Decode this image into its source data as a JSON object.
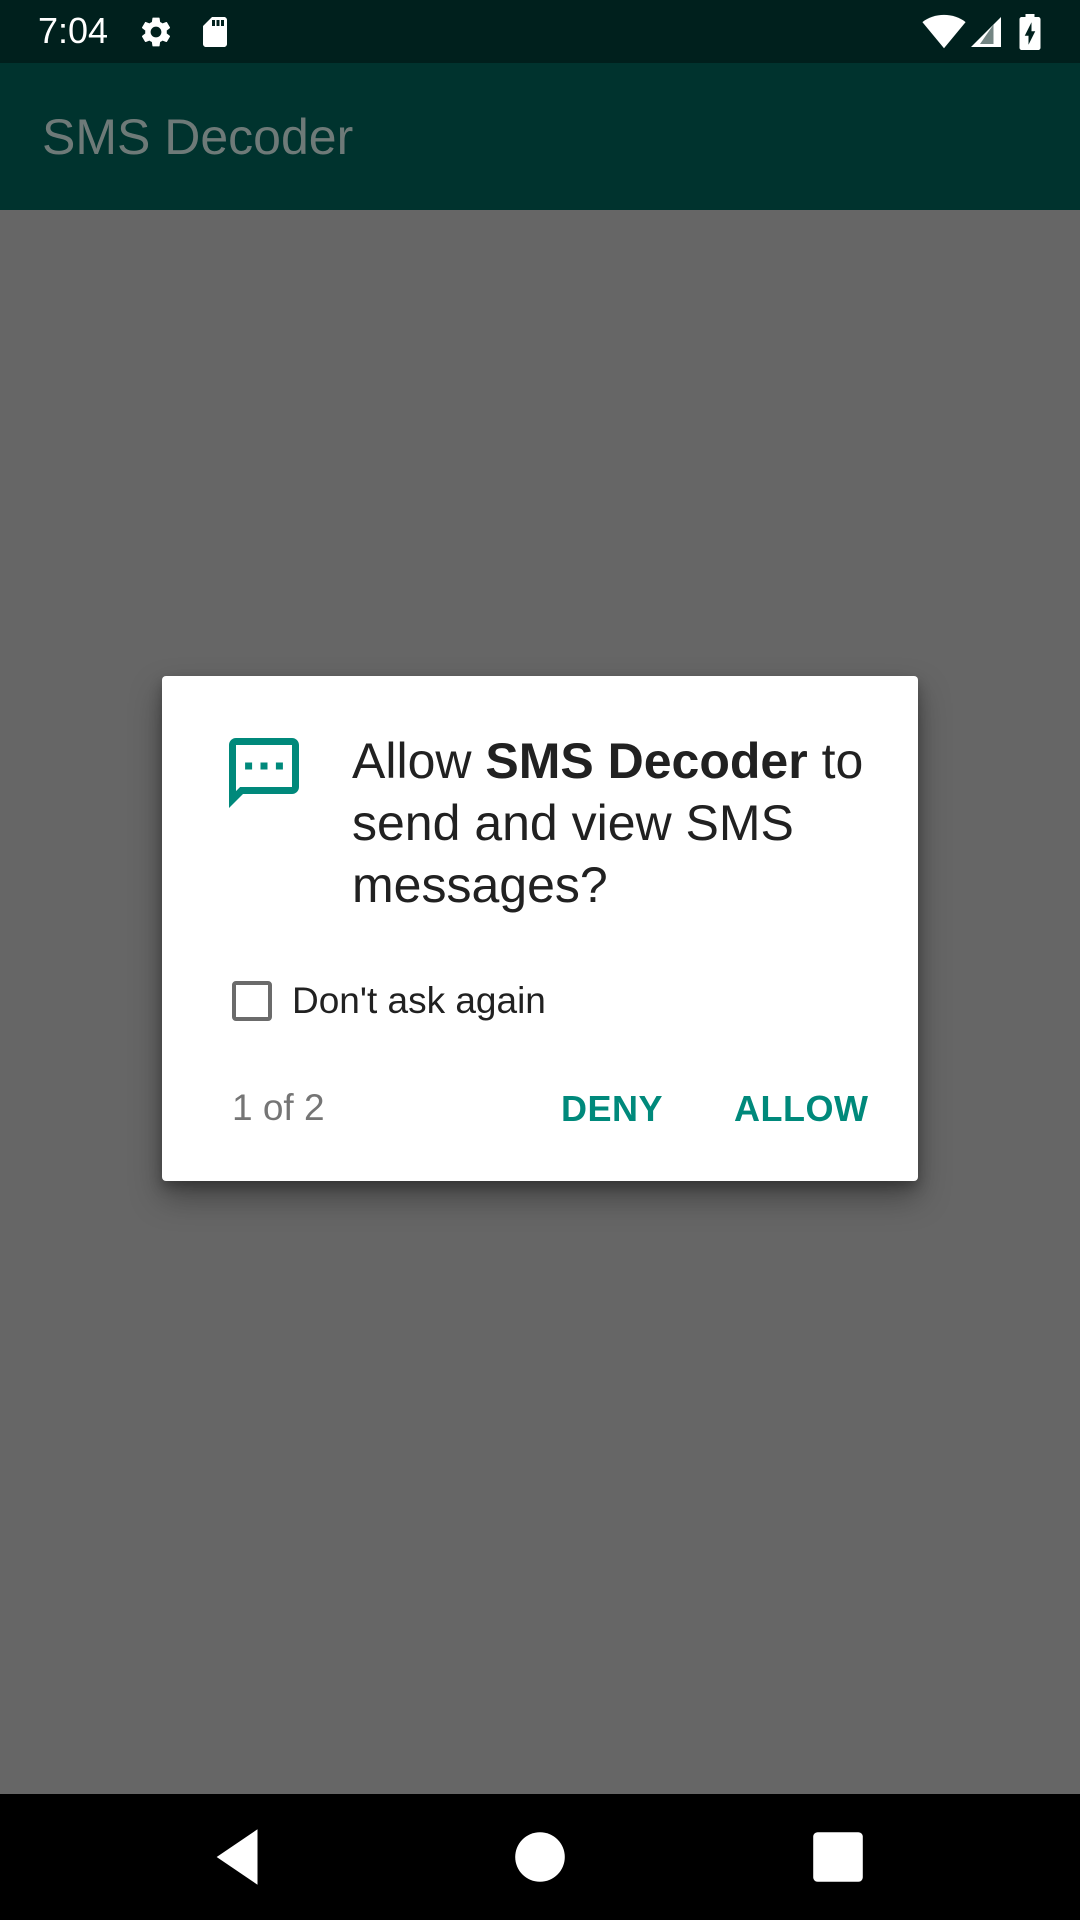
{
  "status_bar": {
    "time": "7:04",
    "icons": [
      "gear-icon",
      "sd-card-icon",
      "wifi-icon",
      "cell-signal-icon",
      "battery-charging-icon"
    ]
  },
  "app_bar": {
    "title": "SMS Decoder"
  },
  "dialog": {
    "icon": "sms-icon",
    "message_prefix": "Allow ",
    "app_name": "SMS Decoder",
    "message_suffix": " to send and view SMS messages?",
    "checkbox_label": "Don't ask again",
    "checkbox_checked": false,
    "page_indicator": "1 of 2",
    "deny_label": "DENY",
    "allow_label": "ALLOW"
  },
  "nav_bar": {
    "buttons": [
      "back-icon",
      "home-icon",
      "recents-icon"
    ]
  },
  "colors": {
    "status_bar": "#00201d",
    "app_bar": "#00332e",
    "accent": "#00897b",
    "scrim": "#666666"
  }
}
